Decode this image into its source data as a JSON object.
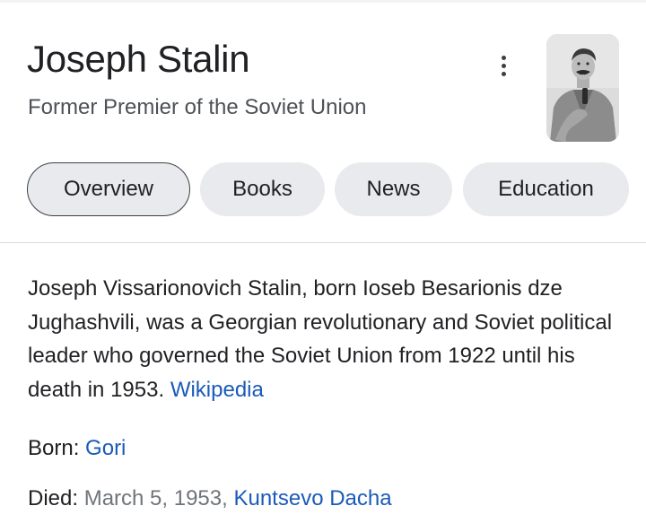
{
  "entity": {
    "title": "Joseph Stalin",
    "subtitle": "Former Premier of the Soviet Union"
  },
  "tabs": [
    {
      "label": "Overview",
      "active": true
    },
    {
      "label": "Books",
      "active": false
    },
    {
      "label": "News",
      "active": false
    },
    {
      "label": "Education",
      "active": false
    }
  ],
  "description": {
    "text": "Joseph Vissarionovich Stalin, born Ioseb Besarionis dze Jughashvili, was a Georgian revolutionary and Soviet political leader who governed the Soviet Union from 1922 until his death in 1953.",
    "source_link": "Wikipedia"
  },
  "facts": {
    "born": {
      "label": "Born:",
      "place": "Gori"
    },
    "died": {
      "label": "Died:",
      "date": "March 5, 1953,",
      "place": "Kuntsevo Dacha"
    }
  },
  "icons": {
    "more": "more-vert-icon"
  },
  "colors": {
    "link": "#1a5bb8",
    "chip_bg": "#e8eaed",
    "text": "#202124",
    "muted": "#70757a"
  }
}
